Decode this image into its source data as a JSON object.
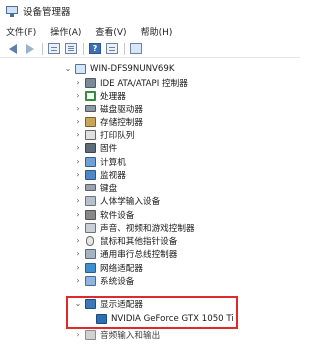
{
  "window": {
    "title": "设备管理器",
    "icon": "device-manager-icon"
  },
  "menu": [
    "文件(F)",
    "操作(A)",
    "查看(V)",
    "帮助(H)"
  ],
  "toolbar": {
    "buttons": [
      "back-arrow-icon",
      "forward-arrow-icon",
      "properties-icon",
      "list-icon",
      "help-icon",
      "details-icon",
      "monitor-icon"
    ]
  },
  "tree": {
    "root": {
      "label": "WIN-DFS9NUNV69K",
      "expanded": true
    },
    "items": [
      {
        "label": "IDE ATA/ATAPI 控制器",
        "icon": "ide-controller-icon",
        "expanded": false
      },
      {
        "label": "处理器",
        "icon": "processor-icon",
        "expanded": false
      },
      {
        "label": "磁盘驱动器",
        "icon": "disk-drive-icon",
        "expanded": false
      },
      {
        "label": "存储控制器",
        "icon": "storage-controller-icon",
        "expanded": false
      },
      {
        "label": "打印队列",
        "icon": "printer-icon",
        "expanded": false
      },
      {
        "label": "固件",
        "icon": "firmware-icon",
        "expanded": false
      },
      {
        "label": "计算机",
        "icon": "computer-icon",
        "expanded": false
      },
      {
        "label": "监视器",
        "icon": "monitor-icon",
        "expanded": false
      },
      {
        "label": "键盘",
        "icon": "keyboard-icon",
        "expanded": false
      },
      {
        "label": "人体学输入设备",
        "icon": "hid-icon",
        "expanded": false
      },
      {
        "label": "软件设备",
        "icon": "software-device-icon",
        "expanded": false
      },
      {
        "label": "声音、视频和游戏控制器",
        "icon": "sound-icon",
        "expanded": false
      },
      {
        "label": "鼠标和其他指针设备",
        "icon": "mouse-icon",
        "expanded": false
      },
      {
        "label": "通用串行总线控制器",
        "icon": "usb-icon",
        "expanded": false
      },
      {
        "label": "网络适配器",
        "icon": "network-adapter-icon",
        "expanded": false
      },
      {
        "label": "系统设备",
        "icon": "system-device-icon",
        "expanded": false
      },
      {
        "label": "显示适配器",
        "icon": "display-adapter-icon",
        "expanded": true,
        "children": [
          {
            "label": "NVIDIA GeForce GTX 1050 Ti",
            "icon": "gpu-icon"
          }
        ]
      },
      {
        "label": "音频输入和输出",
        "icon": "audio-io-icon",
        "expanded": false
      }
    ]
  },
  "highlight_color": "#e02a2a"
}
